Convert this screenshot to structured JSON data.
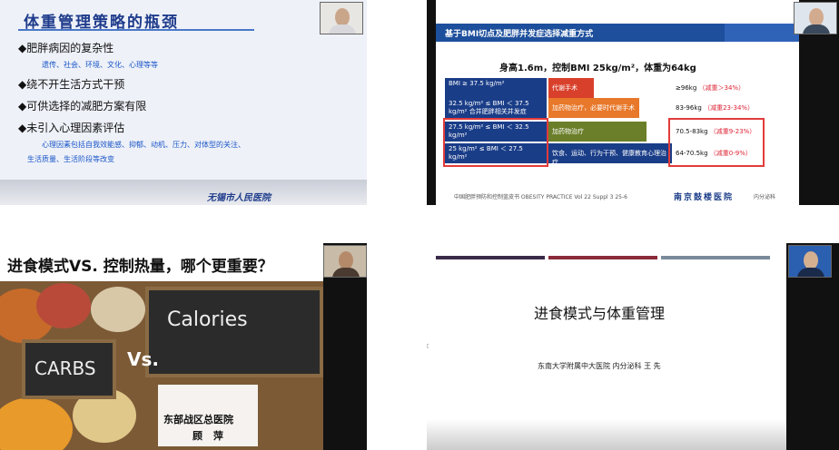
{
  "tile1": {
    "title": "体重管理策略的瓶颈",
    "bullets": [
      {
        "text": "◆肥胖病因的复杂性",
        "sub": "遗传、社会、环境、文化、心理等等"
      },
      {
        "text": "◆绕不开生活方式干预",
        "sub": ""
      },
      {
        "text": "◆可供选择的减肥方案有限",
        "sub": ""
      },
      {
        "text": "◆未引入心理因素评估",
        "sub": "心理因素包括自我效能感、抑郁、动机、压力、对体型的关注、"
      }
    ],
    "sub_extra": "生活质量、生活阶段等改变",
    "logo": "无锡市人民医院"
  },
  "tile2": {
    "header": "基于BMI切点及肥胖并发症选择减重方式",
    "subtitle": "身高1.6m，控制BMI 25kg/m²，体重为64kg",
    "rows": [
      {
        "bmi": "BMI ≥ 37.5 kg/m²",
        "method": "代谢手术",
        "result": "≥96kg",
        "pct": "（减重＞34%）",
        "color": "#d9402b"
      },
      {
        "bmi": "32.5 kg/m² ≤ BMI ＜ 37.5 kg/m² 合并肥胖相关并发症",
        "method": "加药物治疗，必要时代谢手术",
        "result": "83-96kg",
        "pct": "（减重23-34%）",
        "color": "#e8782a"
      },
      {
        "bmi": "27.5 kg/m² ≤ BMI ＜ 32.5 kg/m²",
        "method": "加药物治疗",
        "result": "70.5-83kg",
        "pct": "（减重9-23%）",
        "color": "#6b7f2a"
      },
      {
        "bmi": "25 kg/m² ≤ BMI ＜ 27.5 kg/m²",
        "method": "饮食、运动、行为干预、健康教育心理治疗",
        "result": "64-70.5kg",
        "pct": "（减重0-9%）",
        "color": "#1a3d88"
      }
    ],
    "citation": "中国肥胖预防和控制蓝皮书 OBESITY PRACTICE Vol 22 Suppl 3 25-6",
    "org": "南京鼓楼医院",
    "org_sub": "内分泌科"
  },
  "tile3": {
    "title": "进食模式VS. 控制热量，哪个更重要？",
    "calories": "Calories",
    "vs": "Vs.",
    "carbs": "CARBS",
    "hospital": "东部战区总医院",
    "name": "顾 萍"
  },
  "tile4": {
    "title": "进食模式与体重管理",
    "author": "东南大学附属中大医院 内分泌科 王 先",
    "nav": "‹"
  }
}
